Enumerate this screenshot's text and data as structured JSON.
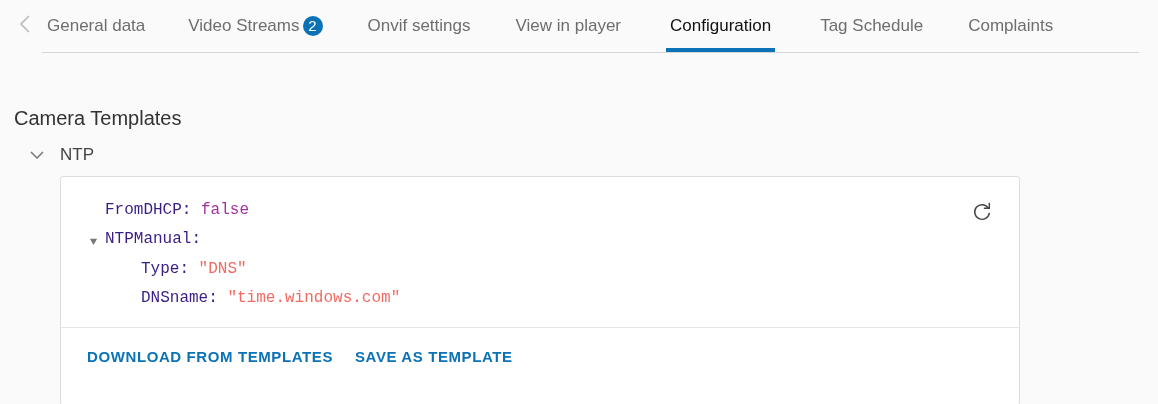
{
  "tabs": [
    {
      "label": "General data",
      "selected": false
    },
    {
      "label": "Video Streams",
      "badge": "2",
      "selected": false
    },
    {
      "label": "Onvif settings",
      "selected": false
    },
    {
      "label": "View in player",
      "selected": false
    },
    {
      "label": "Configuration",
      "selected": true
    },
    {
      "label": "Tag Schedule",
      "selected": false
    },
    {
      "label": "Complaints",
      "selected": false
    }
  ],
  "section": {
    "title": "Camera Templates"
  },
  "group": {
    "label": "NTP",
    "expanded": true
  },
  "tree": [
    {
      "key": "FromDHCP:",
      "kind": "boolean",
      "value": "false"
    },
    {
      "key": "NTPManual:",
      "kind": "object",
      "expanded": true,
      "children": [
        {
          "key": "Type:",
          "kind": "string",
          "value": "\"DNS\""
        },
        {
          "key": "DNSname:",
          "kind": "string",
          "value": "\"time.windows.com\""
        }
      ]
    }
  ],
  "actions": [
    "DOWNLOAD FROM TEMPLATES",
    "SAVE AS TEMPLATE"
  ]
}
